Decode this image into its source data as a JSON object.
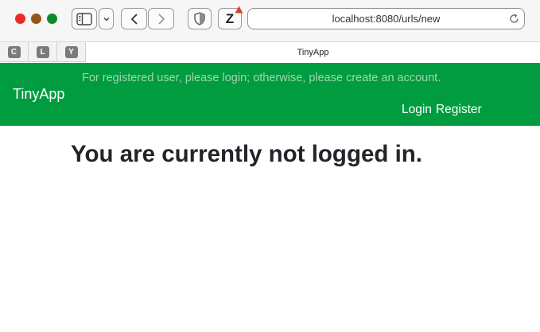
{
  "browser": {
    "address_url": "localhost:8080/urls/new",
    "pinned_tabs": [
      "C",
      "L",
      "Y"
    ],
    "active_tab_title": "TinyApp",
    "extension_label": "Z",
    "colors": {
      "close": "#ec2b27",
      "minimize": "#95561c",
      "maximize": "#0d8a2c",
      "extension_alert": "#d9452a"
    }
  },
  "navbar": {
    "brand": "TinyApp",
    "notice": "For registered user, please login; otherwise, please create an account.",
    "login_label": "Login",
    "register_label": "Register",
    "background": "#009c3f"
  },
  "main": {
    "heading": "You are currently not logged in."
  }
}
